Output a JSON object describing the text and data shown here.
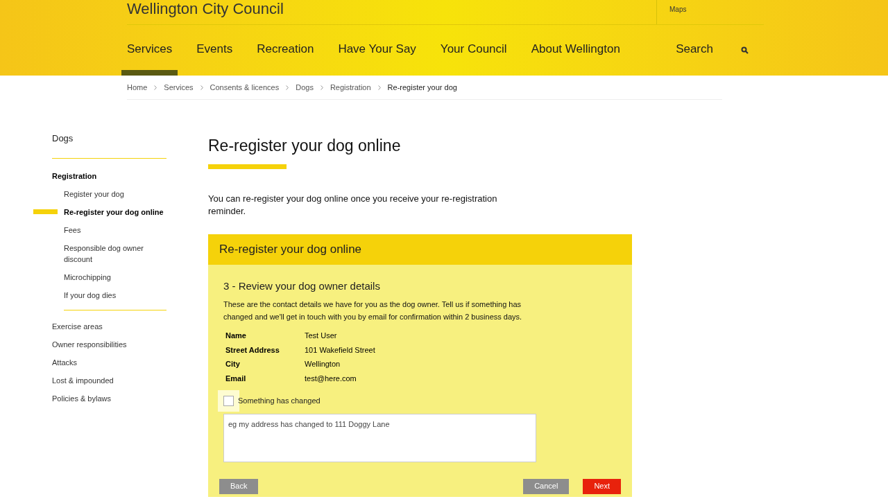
{
  "site": {
    "title": "Wellington City Council",
    "utility_links": [
      "Maps"
    ]
  },
  "nav": {
    "items": [
      {
        "label": "Services",
        "selected": true
      },
      {
        "label": "Events",
        "selected": false
      },
      {
        "label": "Recreation",
        "selected": false
      },
      {
        "label": "Have Your Say",
        "selected": false
      },
      {
        "label": "Your Council",
        "selected": false
      },
      {
        "label": "About Wellington",
        "selected": false
      }
    ],
    "search_label": "Search"
  },
  "breadcrumb": [
    "Home",
    "Services",
    "Consents & licences",
    "Dogs",
    "Registration",
    "Re-register your dog"
  ],
  "sidebar": {
    "title": "Dogs",
    "items": [
      {
        "label": "Registration",
        "selected": false,
        "children": [
          {
            "label": "Register your dog",
            "selected": false
          },
          {
            "label": "Re-register your dog online",
            "selected": true
          },
          {
            "label": "Fees",
            "selected": false
          },
          {
            "label": "Responsible dog owner discount",
            "selected": false
          },
          {
            "label": "Microchipping",
            "selected": false
          },
          {
            "label": "If your dog dies",
            "selected": false
          }
        ]
      },
      {
        "label": "Exercise areas",
        "selected": false
      },
      {
        "label": "Owner responsibilities",
        "selected": false
      },
      {
        "label": "Attacks",
        "selected": false
      },
      {
        "label": "Lost & impounded",
        "selected": false
      },
      {
        "label": "Policies & bylaws",
        "selected": false
      }
    ]
  },
  "page": {
    "title": "Re-register your dog online",
    "intro": "You can re-register your dog online once you receive your re-registration reminder."
  },
  "form": {
    "header": "Re-register your dog online",
    "step_title": "3 - Review your dog owner details",
    "description": "These are the contact details we have for you as the dog owner. Tell us if something has changed and we'll get in touch with you by email for confirmation within 2 business days.",
    "details": [
      {
        "label": "Name",
        "value": "Test User"
      },
      {
        "label": "Street Address",
        "value": "101 Wakefield Street"
      },
      {
        "label": "City",
        "value": "Wellington"
      },
      {
        "label": "Email",
        "value": "test@here.com"
      }
    ],
    "checkbox": {
      "label": "Something has changed",
      "checked": false
    },
    "textarea": {
      "placeholder": "eg my address has changed to 111 Doggy Lane"
    },
    "buttons": [
      {
        "label": "Back",
        "kind": "secondary"
      },
      {
        "label": "Cancel",
        "kind": "secondary"
      },
      {
        "label": "Next",
        "kind": "primary"
      }
    ]
  }
}
